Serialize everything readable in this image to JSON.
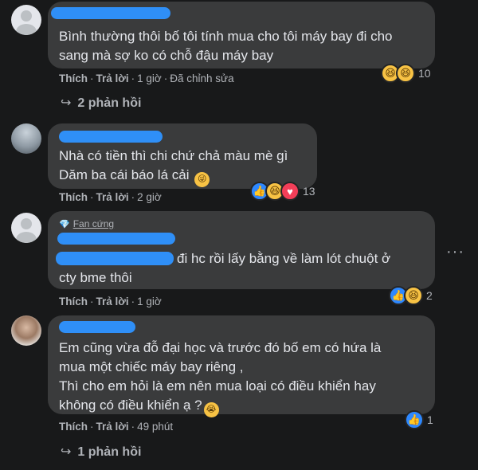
{
  "comments": [
    {
      "text_lines": [
        "Bình thường thôi bố tôi tính mua cho tôi máy bay đi cho",
        "sang mà sợ ko có chỗ đậu máy bay"
      ],
      "like_label": "Thích",
      "reply_label": "Trả lời",
      "time": "1 giờ",
      "edited": "Đã chỉnh sửa",
      "reaction_count": "10",
      "reactions": [
        "haha-icon",
        "haha-icon"
      ],
      "replies_label": "2 phản hồi"
    },
    {
      "text_lines": [
        "Nhà có tiền thì chi chứ chả màu mè gì",
        "Dăm ba cái báo lá cải"
      ],
      "like_label": "Thích",
      "reply_label": "Trả lời",
      "time": "2 giờ",
      "reaction_count": "13",
      "reactions": [
        "like-icon",
        "haha-icon",
        "heart-icon"
      ]
    },
    {
      "badge": "Fan cứng",
      "text_lines": [
        "đi hc rồi lấy bằng về làm lót chuột ở",
        "cty bme thôi"
      ],
      "like_label": "Thích",
      "reply_label": "Trả lời",
      "time": "1 giờ",
      "reaction_count": "2",
      "reactions": [
        "like-icon",
        "haha-icon"
      ]
    },
    {
      "text_lines": [
        "Em cũng vừa đỗ đại học và trước đó bố em có hứa là",
        "mua một chiếc máy bay riêng ,",
        "Thì cho em hỏi là em nên mua loại có điều khiển hay",
        "không có điều khiển ạ ?"
      ],
      "like_label": "Thích",
      "reply_label": "Trả lời",
      "time": "49 phút",
      "reaction_count": "1",
      "reactions": [
        "like-icon"
      ],
      "replies_label": "1 phản hồi"
    }
  ],
  "colors": {
    "bg": "#18191a",
    "bubble": "#3a3b3c",
    "redaction": "#2f8ff7",
    "secondary": "#b0b3b8"
  }
}
